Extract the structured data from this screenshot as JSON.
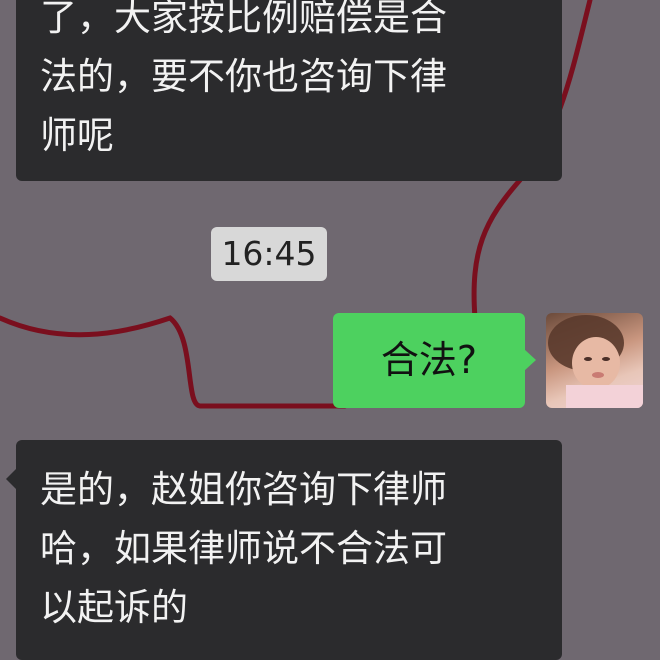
{
  "messages": {
    "incoming_top": {
      "lines": [
        "了，大家按比例赔偿是合",
        "法的，要不你也咨询下律",
        "师呢"
      ]
    },
    "timestamp": "16:45",
    "outgoing": {
      "text": "合法?"
    },
    "incoming_bottom": {
      "lines": [
        "是的，赵姐你咨询下律师",
        "哈，如果律师说不合法可",
        "以起诉的"
      ]
    }
  },
  "colors": {
    "background": "#6f6870",
    "incoming_bubble": "#2b2b2d",
    "outgoing_bubble": "#4dd15f",
    "timestamp_bg": "#d8d8d8",
    "doodle_line": "#7a0f1e"
  },
  "icons": {
    "avatar": "child-photo-avatar"
  }
}
